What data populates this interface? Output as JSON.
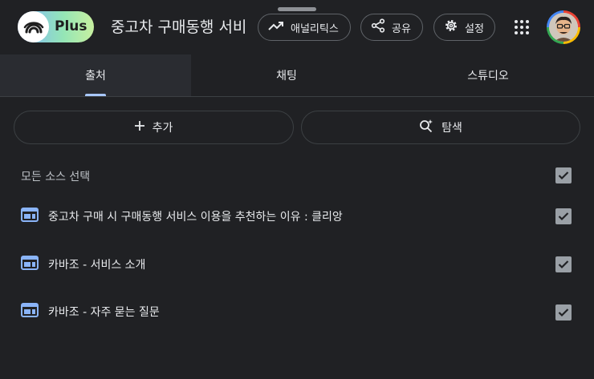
{
  "app": {
    "plan_label": "Plus",
    "title": "중고차 구매동행 서비"
  },
  "toolbar": {
    "analytics_label": "애널리틱스",
    "share_label": "공유",
    "settings_label": "설정"
  },
  "tabs": [
    {
      "label": "출처",
      "active": true
    },
    {
      "label": "채팅",
      "active": false
    },
    {
      "label": "스튜디오",
      "active": false
    }
  ],
  "actions": {
    "add_label": "추가",
    "explore_label": "탐색"
  },
  "sources": {
    "select_all_label": "모든 소스 선택",
    "select_all_checked": true,
    "items": [
      {
        "label": "중고차 구매 시 구매동행 서비스 이용을 추천하는 이유 : 클리앙",
        "icon": "web-page-icon",
        "checked": true
      },
      {
        "label": "카바조 - 서비스 소개",
        "icon": "web-page-icon",
        "checked": true
      },
      {
        "label": "카바조 - 자주 묻는 질문",
        "icon": "web-page-icon",
        "checked": true
      }
    ]
  },
  "colors": {
    "background": "#202124",
    "accent": "#a8c7fa",
    "source_icon": "#8ab4f8",
    "checkbox": "#9aa0a6"
  }
}
